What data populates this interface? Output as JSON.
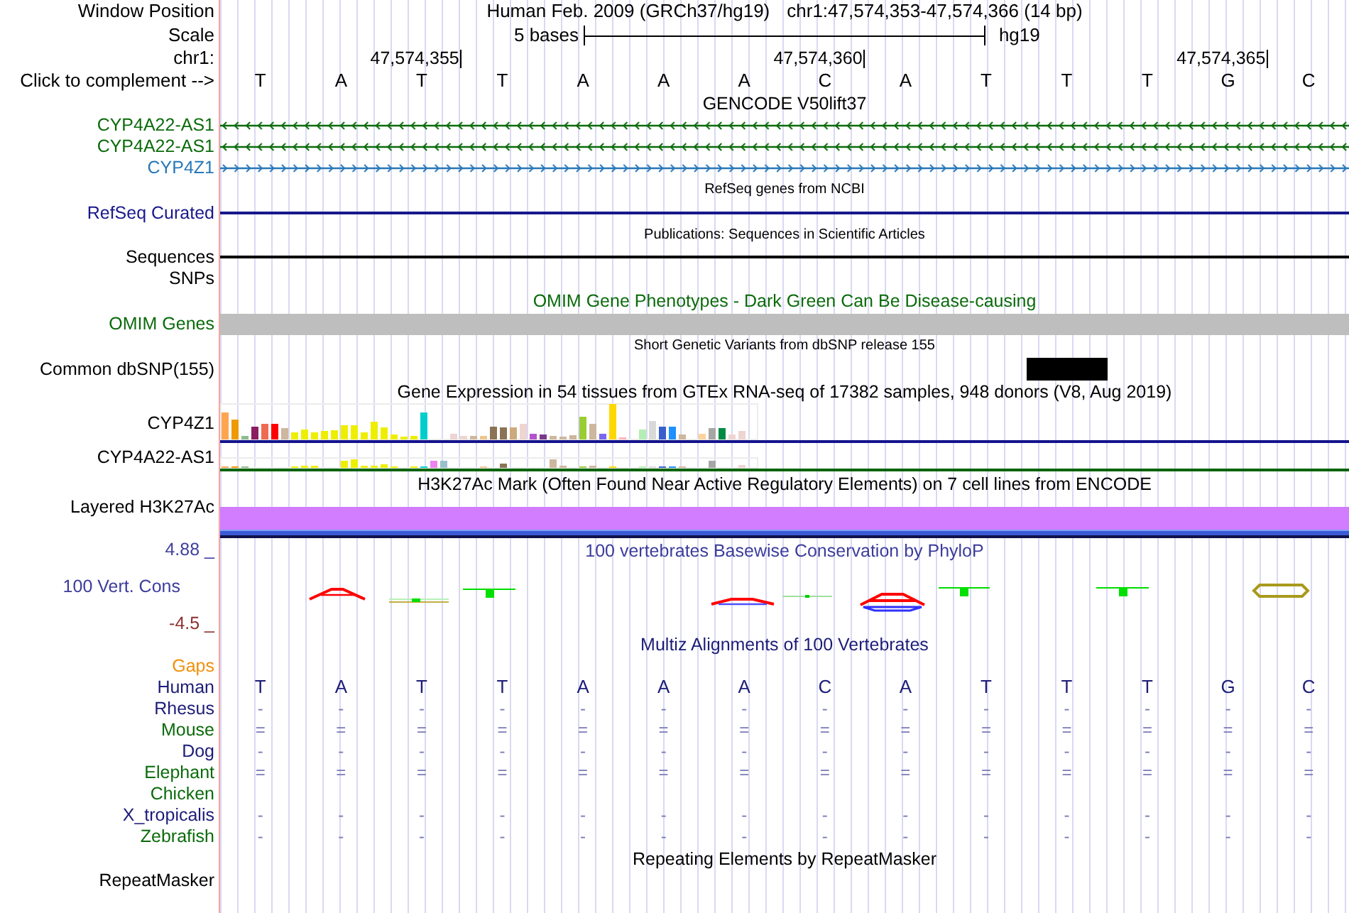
{
  "header": {
    "label": "Window Position",
    "assembly": "Human Feb. 2009 (GRCh37/hg19)",
    "position": "chr1:47,574,353-47,574,366 (14 bp)"
  },
  "scale": {
    "label": "Scale",
    "length": "5 bases",
    "assembly": "hg19"
  },
  "ruler": {
    "label": "chr1:",
    "ticks": [
      "47,574,355",
      "47,574,360",
      "47,574,365"
    ]
  },
  "sequence": {
    "label": "Click to complement -->",
    "bases": [
      "T",
      "A",
      "T",
      "T",
      "A",
      "A",
      "A",
      "C",
      "A",
      "T",
      "T",
      "T",
      "G",
      "C"
    ]
  },
  "tracks": [
    {
      "kind": "full",
      "title": "GENCODE V50lift37",
      "color": "#000000",
      "rows": [
        {
          "kind": "gene",
          "label": "CYP4A22-AS1",
          "color": "#0b6b0b",
          "reverse": true
        },
        {
          "kind": "gene",
          "label": "CYP4A22-AS1",
          "color": "#0b6b0b",
          "reverse": true
        },
        {
          "kind": "gene",
          "label": "CYP4Z1",
          "color": "#2878b8",
          "reverse": false
        }
      ]
    },
    {
      "kind": "compact",
      "title": "RefSeq genes from NCBI",
      "color": "#000000",
      "rows": [
        {
          "kind": "line",
          "label": "RefSeq Curated",
          "color": "#18188c"
        }
      ]
    },
    {
      "kind": "compact",
      "title": "Publications: Sequences in Scientific Articles",
      "color": "#000000",
      "rows": [
        {
          "kind": "line",
          "label": "Sequences",
          "color": "#000000"
        },
        {
          "kind": "empty",
          "label": "SNPs",
          "color": "#000000"
        }
      ]
    },
    {
      "kind": "full",
      "title": "OMIM Gene Phenotypes - Dark Green Can Be Disease-causing",
      "color": "#0b6b0b",
      "rows": [
        {
          "kind": "band",
          "label": "OMIM Genes",
          "color": "#0b6b0b"
        }
      ]
    },
    {
      "kind": "compact",
      "title": "Short Genetic Variants from dbSNP release 155",
      "color": "#000000",
      "rows": [
        {
          "kind": "snp",
          "label": "Common dbSNP(155)",
          "color": "#000000"
        }
      ]
    },
    {
      "kind": "full",
      "title": "Gene Expression in 54 tissues from GTEx RNA-seq of 17382 samples, 948 donors (V8, Aug 2019)",
      "color": "#000000",
      "rows": [
        {
          "kind": "expression",
          "label": "CYP4Z1",
          "color": "#14148c"
        },
        {
          "kind": "expression",
          "label": "CYP4A22-AS1",
          "color": "#0b640b"
        }
      ]
    },
    {
      "kind": "full",
      "title": "H3K27Ac Mark (Often Found Near Active Regulatory Elements) on 7 cell lines from ENCODE",
      "color": "#000000",
      "rows": [
        {
          "kind": "signal",
          "label": "Layered H3K27Ac",
          "color": "#000000"
        }
      ]
    },
    {
      "kind": "full",
      "title": "100 vertebrates Basewise Conservation by PhyloP",
      "color": "#3c3c9c",
      "rows": [
        {
          "kind": "conservation",
          "label": "100 Vert. Cons",
          "color": "#3c3c9c",
          "max": "4.88 _",
          "min": "-4.5 _"
        }
      ]
    },
    {
      "kind": "full",
      "title": "Multiz Alignments of 100 Vertebrates",
      "color": "#1c1c78",
      "rows": [
        {
          "kind": "empty",
          "label": "Gaps",
          "color": "#f0900c"
        },
        {
          "kind": "bases",
          "label": "Human",
          "color": "#1c1c78",
          "cells": [
            "T",
            "A",
            "T",
            "T",
            "A",
            "A",
            "A",
            "C",
            "A",
            "T",
            "T",
            "T",
            "G",
            "C"
          ]
        },
        {
          "kind": "alignment",
          "label": "Rhesus",
          "color": "#1c1c78",
          "cells": [
            "-",
            "-",
            "-",
            "-",
            "-",
            "-",
            "-",
            "-",
            "-",
            "-",
            "-",
            "-",
            "-",
            "-"
          ]
        },
        {
          "kind": "alignment",
          "label": "Mouse",
          "color": "#0b6b0b",
          "cells": [
            "=",
            "=",
            "=",
            "=",
            "=",
            "=",
            "=",
            "=",
            "=",
            "=",
            "=",
            "=",
            "=",
            "="
          ]
        },
        {
          "kind": "alignment",
          "label": "Dog",
          "color": "#1c1c78",
          "cells": [
            "-",
            "-",
            "-",
            "-",
            "-",
            "-",
            "-",
            "-",
            "-",
            "-",
            "-",
            "-",
            "-",
            "-"
          ]
        },
        {
          "kind": "alignment",
          "label": "Elephant",
          "color": "#0b6b0b",
          "cells": [
            "=",
            "=",
            "=",
            "=",
            "=",
            "=",
            "=",
            "=",
            "=",
            "=",
            "=",
            "=",
            "=",
            "="
          ]
        },
        {
          "kind": "empty",
          "label": "Chicken",
          "color": "#0b6b0b"
        },
        {
          "kind": "alignment",
          "label": "X_tropicalis",
          "color": "#1c1c78",
          "cells": [
            "-",
            "-",
            "-",
            "-",
            "-",
            "-",
            "-",
            "-",
            "-",
            "-",
            "-",
            "-",
            "-",
            "-"
          ]
        },
        {
          "kind": "alignment",
          "label": "Zebrafish",
          "color": "#0b6b0b",
          "cells": [
            "-",
            "-",
            "-",
            "-",
            "-",
            "-",
            "-",
            "-",
            "-",
            "-",
            "-",
            "-",
            "-",
            "-"
          ]
        }
      ]
    },
    {
      "kind": "full",
      "title": "Repeating Elements by RepeatMasker",
      "color": "#000000",
      "rows": [
        {
          "kind": "empty",
          "label": "RepeatMasker",
          "color": "#000000"
        }
      ]
    }
  ]
}
